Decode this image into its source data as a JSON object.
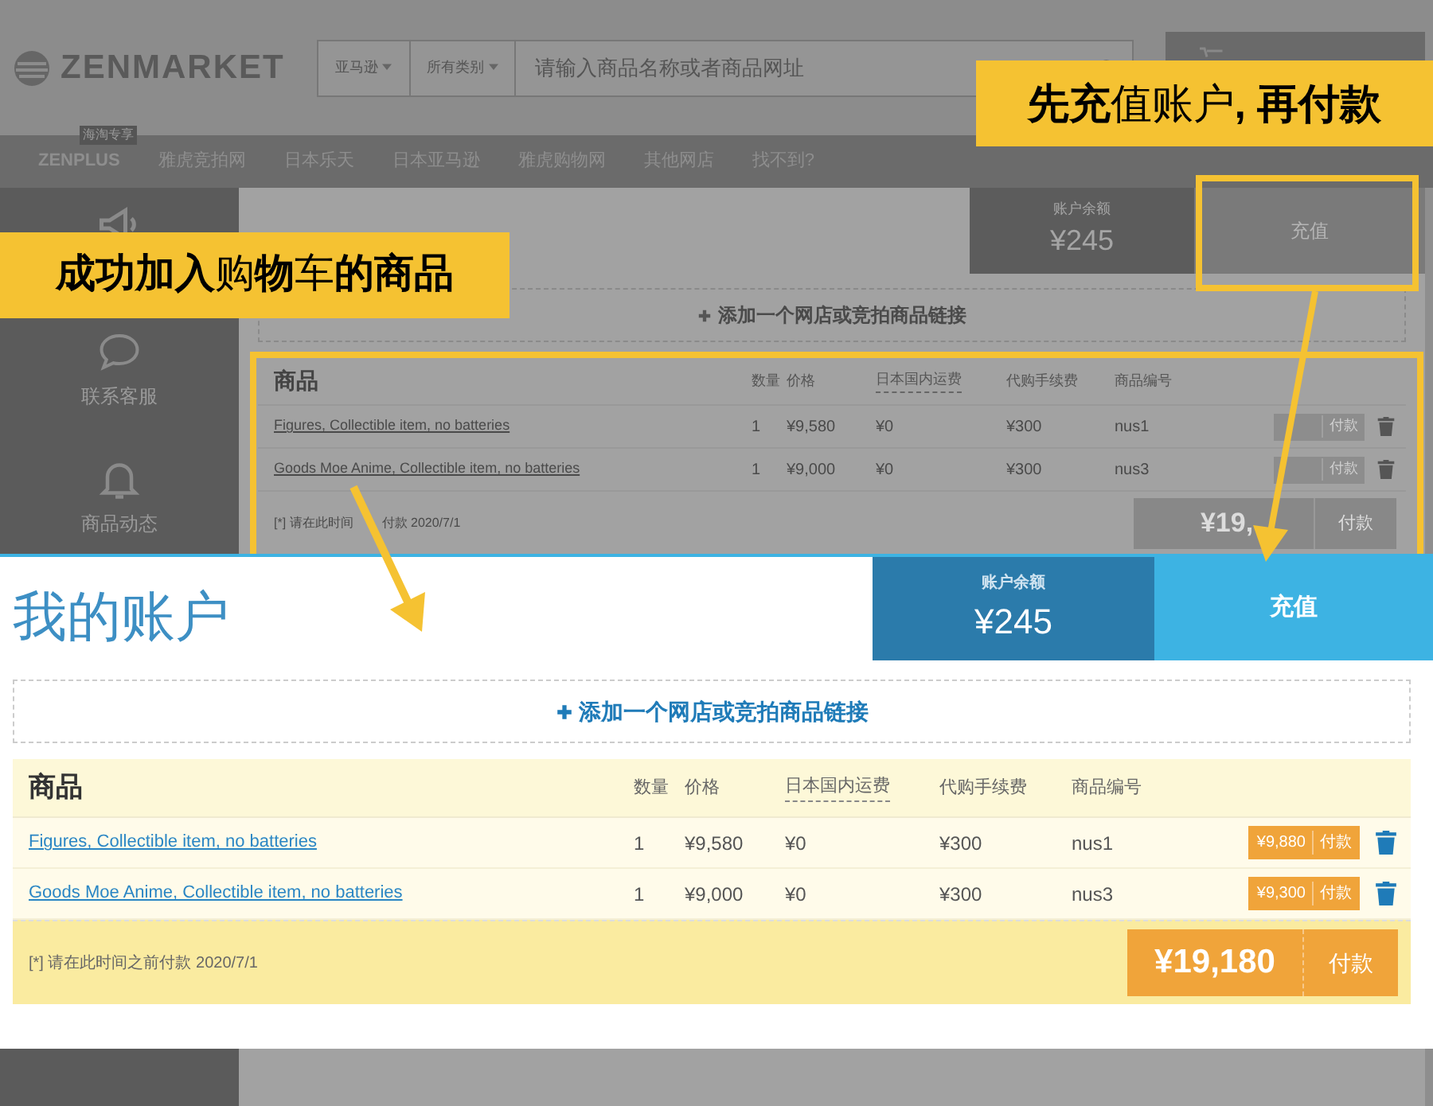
{
  "header": {
    "logo": "ZENMARKET",
    "store_dropdown": "亚马逊",
    "category_dropdown": "所有类别",
    "search_placeholder": "请输入商品名称或者商品网址"
  },
  "nav": {
    "badge": "海淘专享",
    "items": [
      "ZENPLUS",
      "雅虎竞拍网",
      "日本乐天",
      "日本亚马逊",
      "雅虎购物网",
      "其他网店",
      "找不到?"
    ]
  },
  "sidebar": [
    {
      "kind": "megaphone"
    },
    {
      "kind": "chat",
      "label": "联系客服"
    },
    {
      "kind": "bell",
      "label": "商品动态"
    }
  ],
  "background_page": {
    "account": {
      "balance_label": "账户余额",
      "balance": "¥245",
      "topup": "充值",
      "add_link": "添加一个网店或竞拍商品链接"
    },
    "cart": {
      "columns": [
        "商品",
        "数量",
        "价格",
        "日本国内运费",
        "代购手续费",
        "商品编号"
      ],
      "rows": [
        {
          "name": "Figures, Collectible item, no batteries",
          "qty": "1",
          "price": "¥9,580",
          "shipping": "¥0",
          "fee": "¥300",
          "code": "nus1",
          "pay_label": "付款"
        },
        {
          "name": "Goods Moe Anime, Collectible item, no batteries",
          "qty": "1",
          "price": "¥9,000",
          "shipping": "¥0",
          "fee": "¥300",
          "code": "nus3",
          "pay_label": "付款"
        }
      ],
      "footnote_parts": [
        "[*] 请在此时间",
        "付款 2020/7/1"
      ],
      "total": "¥19,",
      "total_pay_label": "付款"
    }
  },
  "account": {
    "title": "我的账户",
    "balance_label": "账户余额",
    "balance": "¥245",
    "topup": "充值",
    "add_link": "添加一个网店或竞拍商品链接"
  },
  "cart": {
    "columns": [
      "商品",
      "数量",
      "价格",
      "日本国内运费",
      "代购手续费",
      "商品编号"
    ],
    "rows": [
      {
        "name": "Figures, Collectible item, no batteries",
        "qty": "1",
        "price": "¥9,580",
        "shipping": "¥0",
        "fee": "¥300",
        "code": "nus1",
        "pay_amount": "¥9,880",
        "pay_label": "付款"
      },
      {
        "name": "Goods Moe Anime, Collectible item, no batteries",
        "qty": "1",
        "price": "¥9,000",
        "shipping": "¥0",
        "fee": "¥300",
        "code": "nus3",
        "pay_amount": "¥9,300",
        "pay_label": "付款"
      }
    ],
    "footnote_parts": [
      "[*] 请在此时间之前付款 2020/7/1"
    ],
    "total": "¥19,180",
    "total_pay_label": "付款"
  },
  "callouts": [
    {
      "text": "**先充**值账户**, 再付款**"
    },
    {
      "text": "**成功加入**购**物**车**的商品**"
    }
  ]
}
